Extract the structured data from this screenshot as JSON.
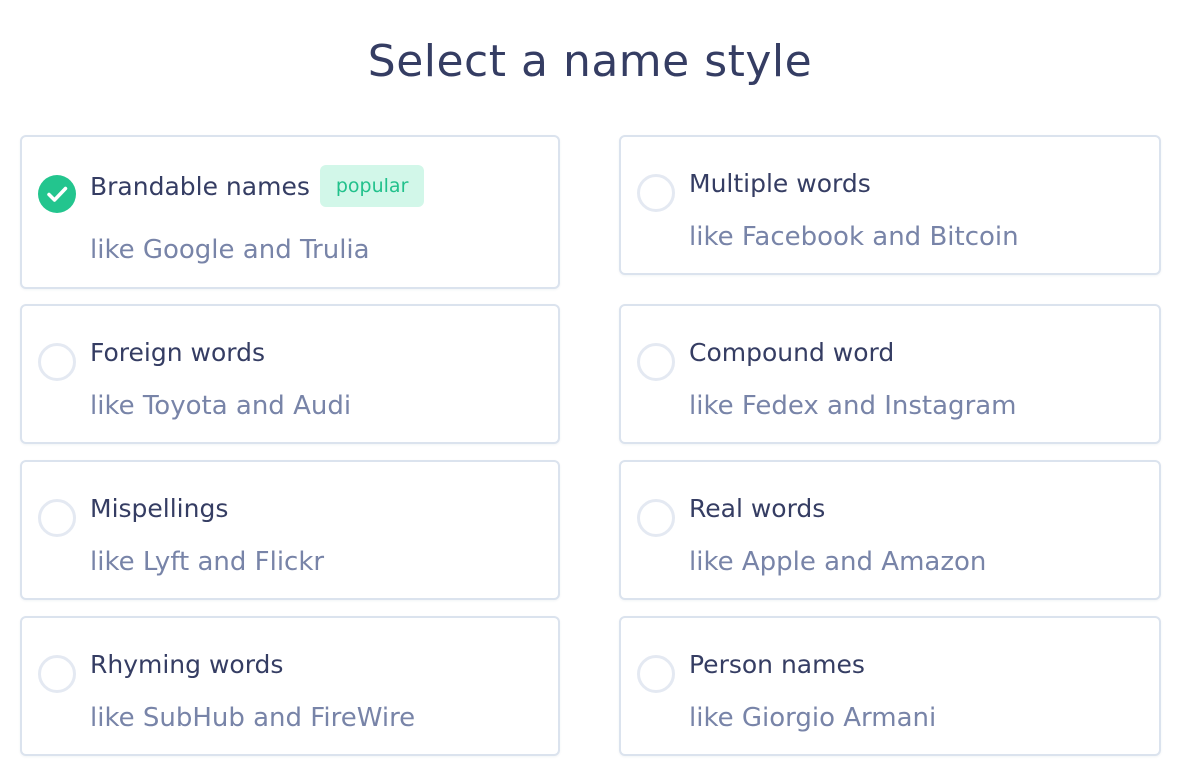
{
  "header": {
    "title": "Select a name style"
  },
  "options": [
    {
      "label": "Brandable names",
      "badge": "popular",
      "example": "like Google and Trulia",
      "selected": true
    },
    {
      "label": "Multiple words",
      "example": "like Facebook and Bitcoin",
      "selected": false
    },
    {
      "label": "Foreign words",
      "example": "like Toyota and Audi",
      "selected": false
    },
    {
      "label": "Compound word",
      "example": "like Fedex and Instagram",
      "selected": false
    },
    {
      "label": "Mispellings",
      "example": "like Lyft and Flickr",
      "selected": false
    },
    {
      "label": "Real words",
      "example": "like Apple and Amazon",
      "selected": false
    },
    {
      "label": "Rhyming words",
      "example": "like SubHub and FireWire",
      "selected": false
    },
    {
      "label": "Person names",
      "example": "like Giorgio Armani",
      "selected": false
    }
  ],
  "colors": {
    "accent": "#23c58e",
    "title": "#353d63",
    "subtitle": "#7884a8",
    "border": "#dbe3ee"
  },
  "icons": {
    "selected": "checkmark-icon",
    "unselected": "radio-circle-icon"
  }
}
